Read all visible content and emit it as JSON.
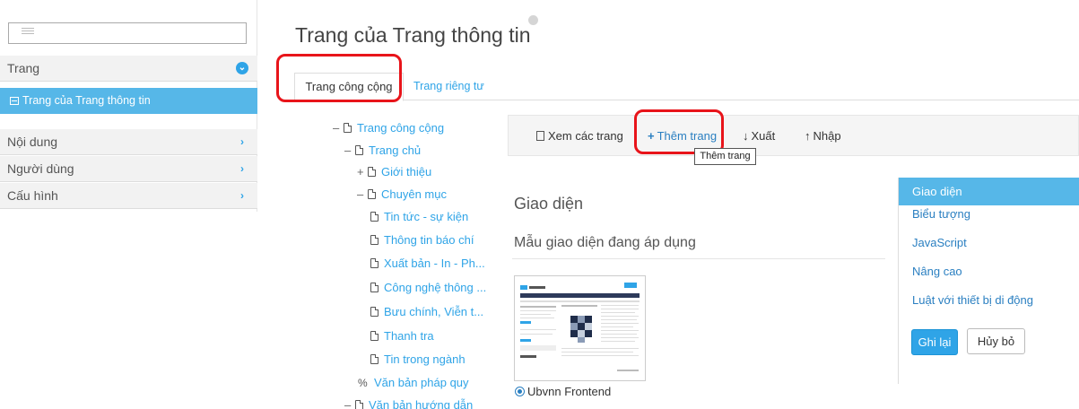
{
  "sidebar": {
    "search_placeholder": "",
    "trang_label": "Trang",
    "active_item": "Trang của Trang thông tin",
    "items": [
      {
        "label": "Nội dung"
      },
      {
        "label": "Người dùng"
      },
      {
        "label": "Cấu hình"
      }
    ]
  },
  "header": {
    "title": "Trang của Trang thông tin"
  },
  "tabs": [
    {
      "label": "Trang công cộng",
      "active": true
    },
    {
      "label": "Trang riêng tư",
      "active": false
    }
  ],
  "tree": [
    {
      "toggle": "–",
      "label": "Trang công cộng",
      "icon": "doc-icon"
    },
    {
      "toggle": "–",
      "label": "Trang chủ",
      "icon": "doc-icon"
    },
    {
      "toggle": "+",
      "label": "Giới thiệu",
      "icon": "doc-icon"
    },
    {
      "toggle": "–",
      "label": "Chuyên mục",
      "icon": "doc-icon"
    },
    {
      "toggle": "",
      "label": "Tin tức - sự kiện",
      "icon": "doc-icon"
    },
    {
      "toggle": "",
      "label": "Thông tin báo chí",
      "icon": "doc-icon"
    },
    {
      "toggle": "",
      "label": "Xuất bản - In - Ph...",
      "icon": "doc-icon"
    },
    {
      "toggle": "",
      "label": "Công nghệ thông ...",
      "icon": "doc-icon"
    },
    {
      "toggle": "",
      "label": "Bưu chính, Viễn t...",
      "icon": "doc-icon"
    },
    {
      "toggle": "",
      "label": "Thanh tra",
      "icon": "doc-icon"
    },
    {
      "toggle": "",
      "label": "Tin trong ngành",
      "icon": "doc-icon"
    },
    {
      "toggle": "",
      "label": "Văn bản pháp quy",
      "icon": "link-icon"
    },
    {
      "toggle": "–",
      "label": "Văn bản hướng dẫn",
      "icon": "doc-icon"
    }
  ],
  "toolbar": {
    "view_label": "Xem các trang",
    "add_label": "Thêm trang",
    "export_label": "Xuất",
    "import_label": "Nhập",
    "tooltip": "Thêm trang"
  },
  "content": {
    "section_title": "Giao diện",
    "subtitle": "Mẫu giao diện đang áp dụng",
    "theme_name": "Ubvnn Frontend"
  },
  "right_panel": {
    "items": [
      {
        "label": "Giao diện",
        "active": true
      },
      {
        "label": "Biểu tượng"
      },
      {
        "label": "JavaScript"
      },
      {
        "label": "Nâng cao"
      },
      {
        "label": "Luật với thiết bị di động"
      }
    ],
    "save_label": "Ghi lại",
    "cancel_label": "Hủy bỏ"
  },
  "colors": {
    "accent": "#2fa4e7",
    "active_bg": "#56b7e8",
    "highlight": "#e8141a"
  }
}
